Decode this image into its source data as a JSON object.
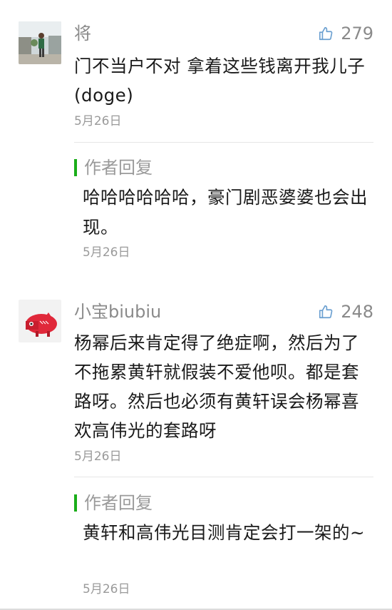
{
  "comments": [
    {
      "user": "将",
      "likes": "279",
      "text": "门不当户不对  拿着这些钱离开我儿子(doge)",
      "date": "5月26日",
      "reply": {
        "label": "作者回复",
        "text": "哈哈哈哈哈哈，豪门剧恶婆婆也会出现。",
        "date": "5月26日"
      }
    },
    {
      "user": "小宝biubiu",
      "likes": "248",
      "text": "杨幂后来肯定得了绝症啊，然后为了不拖累黄轩就假装不爱他呗。都是套路呀。然后也必须有黄轩误会杨幂喜欢高伟光的套路呀",
      "date": "5月26日",
      "reply": {
        "label": "作者回复",
        "text": "黄轩和高伟光目测肯定会打一架的~",
        "date": "5月26日"
      }
    }
  ],
  "icons": {
    "like": "thumbs-up-icon"
  },
  "colors": {
    "accent": "#1aad19",
    "meta": "#8a8a8a"
  }
}
